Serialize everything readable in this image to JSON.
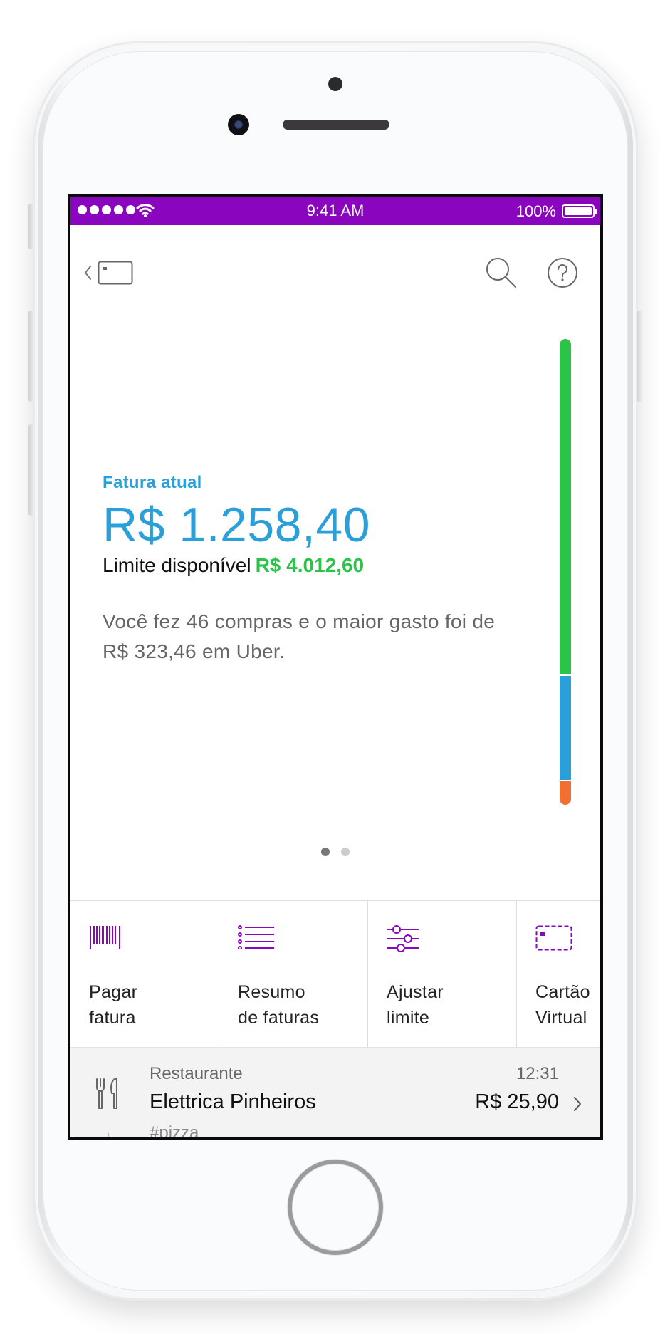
{
  "status_bar": {
    "time": "9:41 AM",
    "battery": "100%",
    "signal_icon": "signal-dots-icon",
    "wifi_icon": "wifi-icon",
    "battery_icon": "battery-icon",
    "background": "#8a05be"
  },
  "nav": {
    "back_icon": "chevron-left-icon",
    "card_icon": "card-icon",
    "search_icon": "search-icon",
    "help_icon": "help-icon"
  },
  "summary": {
    "label": "Fatura atual",
    "amount": "R$ 1.258,40",
    "limit_label": "Limite disponível",
    "limit_value": "R$ 4.012,60",
    "description": "Você fez 46 compras e o maior gasto foi de R$ 323,46 em Uber."
  },
  "limit_bar": {
    "segments": [
      {
        "name": "limite disponível",
        "value": 4012.6,
        "color": "#2bc348"
      },
      {
        "name": "fatura atual",
        "value": 1258.4,
        "color": "#2a9fda"
      },
      {
        "name": "outros",
        "value": 300,
        "color": "#f26f33"
      }
    ]
  },
  "pager": {
    "pages": 2,
    "active": 1
  },
  "actions": [
    {
      "label": "Pagar\nfatura",
      "icon": "barcode-icon"
    },
    {
      "label": "Resumo\nde faturas",
      "icon": "list-icon"
    },
    {
      "label": "Ajustar\nlimite",
      "icon": "sliders-icon"
    },
    {
      "label": "Cartão\nVirtual",
      "icon": "virtual-card-icon"
    }
  ],
  "transaction": {
    "category": "Restaurante",
    "time": "12:31",
    "name": "Elettrica Pinheiros",
    "amount": "R$ 25,90",
    "tag": "#pizza",
    "icon": "cutlery-icon"
  },
  "colors": {
    "accent": "#8a05be",
    "blue": "#2a9fda",
    "green": "#2bc348",
    "orange": "#f26f33"
  }
}
